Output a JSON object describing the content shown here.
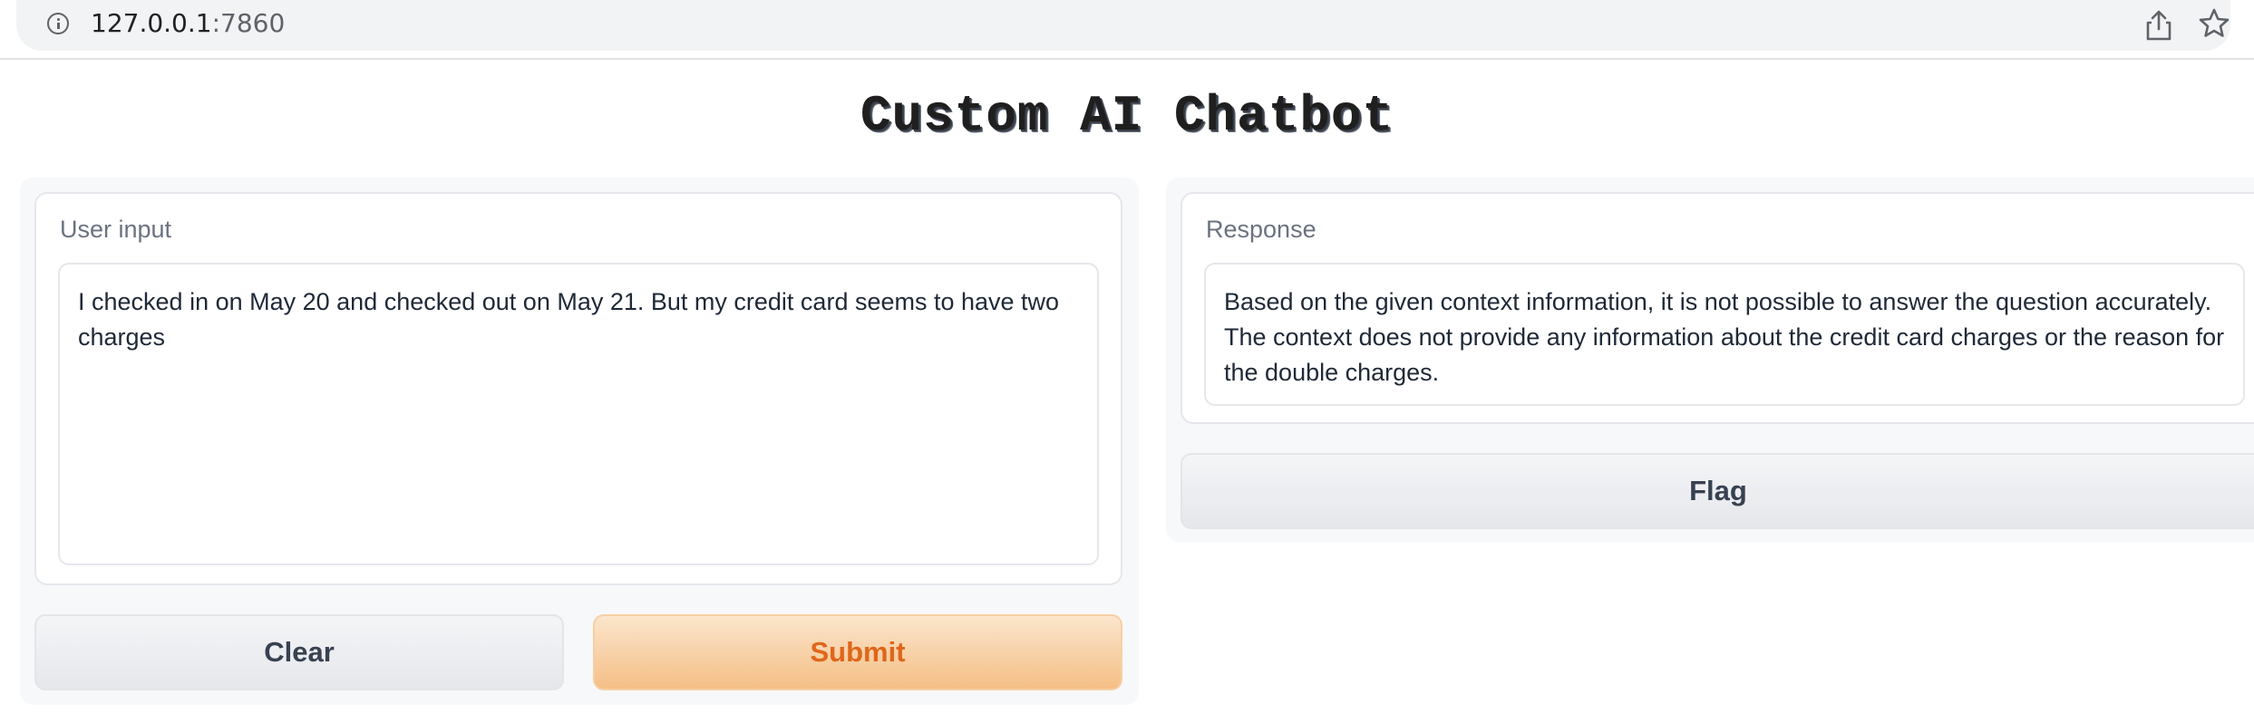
{
  "browser": {
    "url_host": "127.0.0.1",
    "url_port": ":7860",
    "icons": [
      "info-icon",
      "share-icon",
      "star-icon"
    ]
  },
  "page": {
    "title": "Custom AI Chatbot"
  },
  "input_panel": {
    "label": "User input",
    "value": "I checked in on May 20 and checked out on May 21. But my credit card seems to have two charges",
    "clear_label": "Clear",
    "submit_label": "Submit"
  },
  "output_panel": {
    "label": "Response",
    "value": "Based on the given context information, it is not possible to answer the question accurately. The context does not provide any information about the credit card charges or the reason for the double charges.",
    "flag_label": "Flag"
  },
  "colors": {
    "primary_text": "#e0661a",
    "primary_bg": "#f5bf86",
    "secondary_bg": "#e5e7eb"
  }
}
